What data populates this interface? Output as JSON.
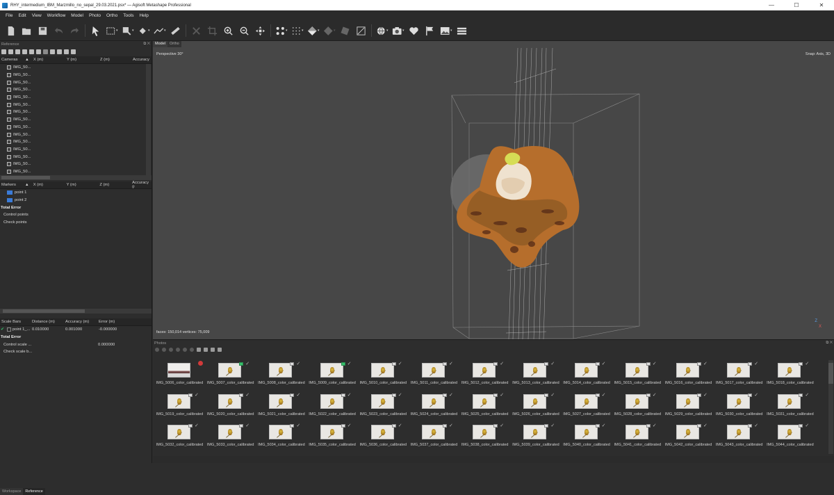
{
  "window": {
    "title": "RHY_intermedium_IBM_Marzmillo_no_sepal_29.03.2021.psx* — Agisoft Metashape Professional",
    "min": "—",
    "max": "☐",
    "close": "✕"
  },
  "menu": [
    "File",
    "Edit",
    "View",
    "Workflow",
    "Model",
    "Photo",
    "Ortho",
    "Tools",
    "Help"
  ],
  "toolbar": {
    "icons": [
      "new-icon",
      "open-icon",
      "save-icon",
      "undo-icon",
      "redo-icon",
      "select-cursor-icon",
      "rectangle-selection-icon",
      "crop-icon",
      "ruler-icon",
      "delete-icon",
      "crop-region-icon",
      "zoom-in-icon",
      "zoom-out-icon",
      "navigate-icon",
      "points-icon",
      "dense-cloud-icon",
      "shaded-model-icon",
      "solid-model-icon",
      "texture-model-icon",
      "tiled-model-icon",
      "globe-icon",
      "camera-icon",
      "heart-shape-icon",
      "flag-icon",
      "image-icon",
      "layers-icon"
    ]
  },
  "reference": {
    "title": "Reference",
    "cameras_header": {
      "name": "Cameras",
      "x": "X (m)",
      "y": "Y (m)",
      "z": "Z (m)",
      "acc": "Accuracy"
    },
    "cameras": [
      "IMG_50...",
      "IMG_50...",
      "IMG_50...",
      "IMG_50...",
      "IMG_50...",
      "IMG_50...",
      "IMG_50...",
      "IMG_50...",
      "IMG_50...",
      "IMG_50...",
      "IMG_50...",
      "IMG_50...",
      "IMG_50...",
      "IMG_50...",
      "IMG_50..."
    ],
    "markers_header": {
      "name": "Markers",
      "x": "X (m)",
      "y": "Y (m)",
      "z": "Z (m)",
      "acc": "Accuracy (r"
    },
    "markers": [
      "point 1",
      "point 2"
    ],
    "total_error": "Total Error",
    "control_points": "Control points",
    "check_points": "Check points",
    "scalebars_header": {
      "name": "Scale Bars",
      "dist": "Distance (m)",
      "acc": "Accuracy (m)",
      "err": "Error (m)"
    },
    "scalebar": {
      "name": "point 1_...",
      "dist": "0.010000",
      "acc": "0.001000",
      "err": "-0.000000"
    },
    "sb_total_error": "Total Error",
    "control_scale": "Control scale ...",
    "control_scale_err": "0.000000",
    "check_scale": "Check scale b..."
  },
  "viewport": {
    "tabs": [
      "Model",
      "Ortho"
    ],
    "projection": "Perspective 30°",
    "snap": "Snap: Axis, 3D",
    "stats": "faces: 150,014 vertices: 75,009",
    "axis_z": "Z",
    "axis_x": "X"
  },
  "photos": {
    "title": "Photos",
    "items": [
      "IMG_5006_color_calibrated",
      "IMG_5007_color_calibrated",
      "IMG_5008_color_calibrated",
      "IMG_5009_color_calibrated",
      "IMG_5010_color_calibrated",
      "IMG_5011_color_calibrated",
      "IMG_5012_color_calibrated",
      "IMG_5013_color_calibrated",
      "IMG_5014_color_calibrated",
      "IMG_5015_color_calibrated",
      "IMG_5016_color_calibrated",
      "IMG_5017_color_calibrated",
      "IMG_5018_color_calibrated",
      "IMG_5019_color_calibrated",
      "IMG_5020_color_calibrated",
      "IMG_5021_color_calibrated",
      "IMG_5022_color_calibrated",
      "IMG_5023_color_calibrated",
      "IMG_5024_color_calibrated",
      "IMG_5025_color_calibrated",
      "IMG_5026_color_calibrated",
      "IMG_5027_color_calibrated",
      "IMG_5028_color_calibrated",
      "IMG_5029_color_calibrated",
      "IMG_5030_color_calibrated",
      "IMG_5031_color_calibrated",
      "IMG_5032_color_calibrated",
      "IMG_5033_color_calibrated",
      "IMG_5034_color_calibrated",
      "IMG_5035_color_calibrated",
      "IMG_5036_color_calibrated",
      "IMG_5037_color_calibrated",
      "IMG_5038_color_calibrated",
      "IMG_5039_color_calibrated",
      "IMG_5040_color_calibrated",
      "IMG_5041_color_calibrated",
      "IMG_5042_color_calibrated",
      "IMG_5043_color_calibrated",
      "IMG_5044_color_calibrated"
    ]
  },
  "bottom_tabs": [
    "Workspace",
    "Reference"
  ],
  "colors": {
    "accent_green": "#36c26b",
    "accent_red": "#d23a3a",
    "marker_flag": "#3a7bd8"
  }
}
